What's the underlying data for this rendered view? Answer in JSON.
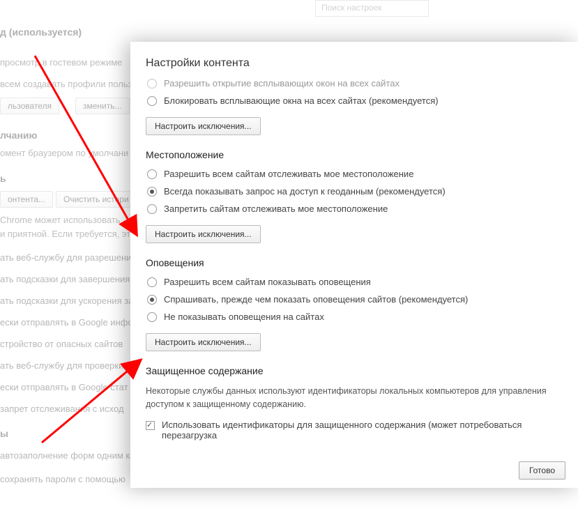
{
  "search": {
    "placeholder": "Поиск настроек"
  },
  "bg": {
    "heading1": "д (используется)",
    "t_guest": "просмотр в гостевом режиме",
    "t_allowcreate": "всем создавать профили польз",
    "btn_user": "льзователя",
    "btn_change": "зменить...",
    "heading2": "лчанию",
    "t_defbr": "омент браузером по умолчани",
    "heading3": "ь",
    "btn_content": "онтента...",
    "btn_clear": "Очистить истори",
    "t_chrome1": "Chrome может использовать",
    "t_chrome2": "и приятной. Если требуется, эт",
    "c1": "ать веб-службу для разрешени",
    "c2": "ать подсказки для завершения",
    "c3": "ать подсказки для ускорения за",
    "c4": "ески отправлять в Google инфо",
    "c5": "стройство от опасных сайтов",
    "c6": "ать веб-службу для проверки п",
    "c7": "ески отправлять в Google стат",
    "c8": "запрет отслеживания с исход",
    "heading4": "ы",
    "c9": "автозаполнение форм одним кл",
    "c10": "сохранять пароли с помощью"
  },
  "modal": {
    "title": "Настройки контента",
    "popups": {
      "opt_allow": "Разрешить открытие всплывающих окон на всех сайтах",
      "opt_block": "Блокировать всплывающие окна на всех сайтах (рекомендуется)",
      "manage": "Настроить исключения..."
    },
    "location": {
      "title": "Местоположение",
      "opt_allow": "Разрешить всем сайтам отслеживать мое местоположение",
      "opt_ask": "Всегда показывать запрос на доступ к геоданным (рекомендуется)",
      "opt_block": "Запретить сайтам отслеживать мое местоположение",
      "manage": "Настроить исключения..."
    },
    "notifications": {
      "title": "Оповещения",
      "opt_allow": "Разрешить всем сайтам показывать оповещения",
      "opt_ask": "Спрашивать, прежде чем показать оповещения сайтов (рекомендуется)",
      "opt_block": "Не показывать оповещения на сайтах",
      "manage": "Настроить исключения..."
    },
    "protected": {
      "title": "Защищенное содержание",
      "desc": "Некоторые службы данных используют идентификаторы локальных компьютеров для управления доступом к защищенному содержанию.",
      "check": "Использовать идентификаторы для защищенного содержания (может потребоваться перезагрузка"
    },
    "done": "Готово"
  }
}
